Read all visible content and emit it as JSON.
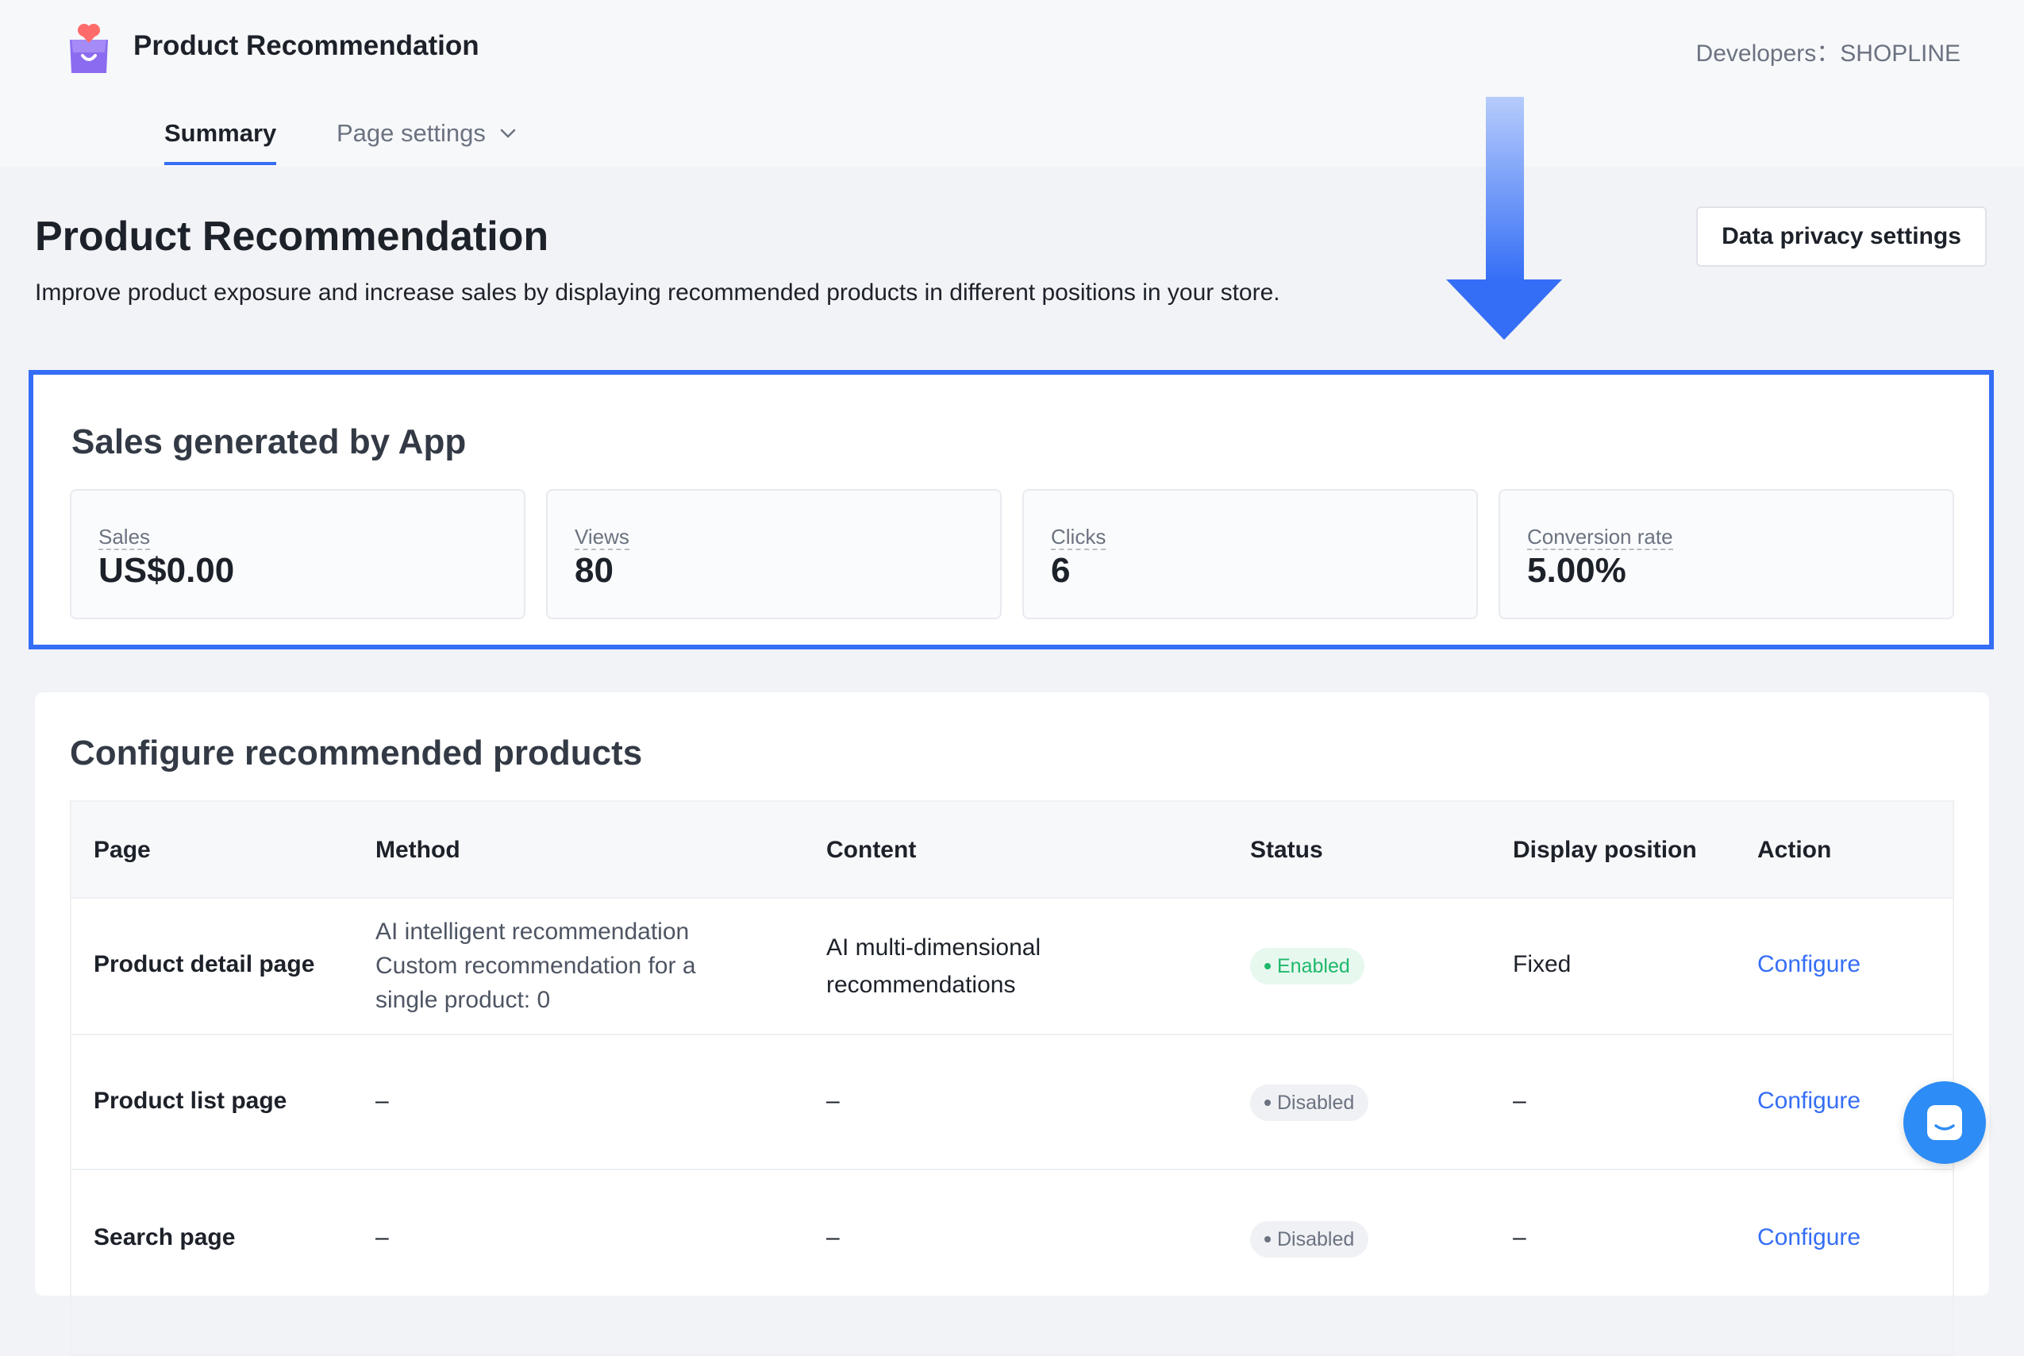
{
  "header": {
    "app_title": "Product Recommendation",
    "developer": "Developers：SHOPLINE"
  },
  "tabs": [
    {
      "label": "Summary",
      "active": true
    },
    {
      "label": "Page settings",
      "active": false
    }
  ],
  "page": {
    "title": "Product Recommendation",
    "description": "Improve product exposure and increase sales by displaying recommended products in different positions in your store.",
    "privacy_button": "Data privacy settings"
  },
  "sales": {
    "title": "Sales generated by App",
    "stats": [
      {
        "label": "Sales",
        "value": "US$0.00"
      },
      {
        "label": "Views",
        "value": "80"
      },
      {
        "label": "Clicks",
        "value": "6"
      },
      {
        "label": "Conversion rate",
        "value": "5.00%"
      }
    ]
  },
  "config": {
    "title": "Configure recommended products",
    "columns": [
      "Page",
      "Method",
      "Content",
      "Status",
      "Display position",
      "Action"
    ],
    "rows": [
      {
        "page": "Product detail page",
        "method": [
          "AI intelligent recommendation",
          "Custom recommendation for a",
          "single product: 0"
        ],
        "content": [
          "AI multi-dimensional",
          "recommendations"
        ],
        "status": "Enabled",
        "position": "Fixed",
        "action": "Configure"
      },
      {
        "page": "Product list page",
        "method": [
          "–"
        ],
        "content": [
          "–"
        ],
        "status": "Disabled",
        "position": "–",
        "action": "Configure"
      },
      {
        "page": "Search page",
        "method": [
          "–"
        ],
        "content": [
          "–"
        ],
        "status": "Disabled",
        "position": "–",
        "action": "Configure"
      }
    ]
  },
  "colors": {
    "accent": "#356ef6",
    "enabled": "#1fb86b",
    "chat": "#2d8cf5"
  }
}
